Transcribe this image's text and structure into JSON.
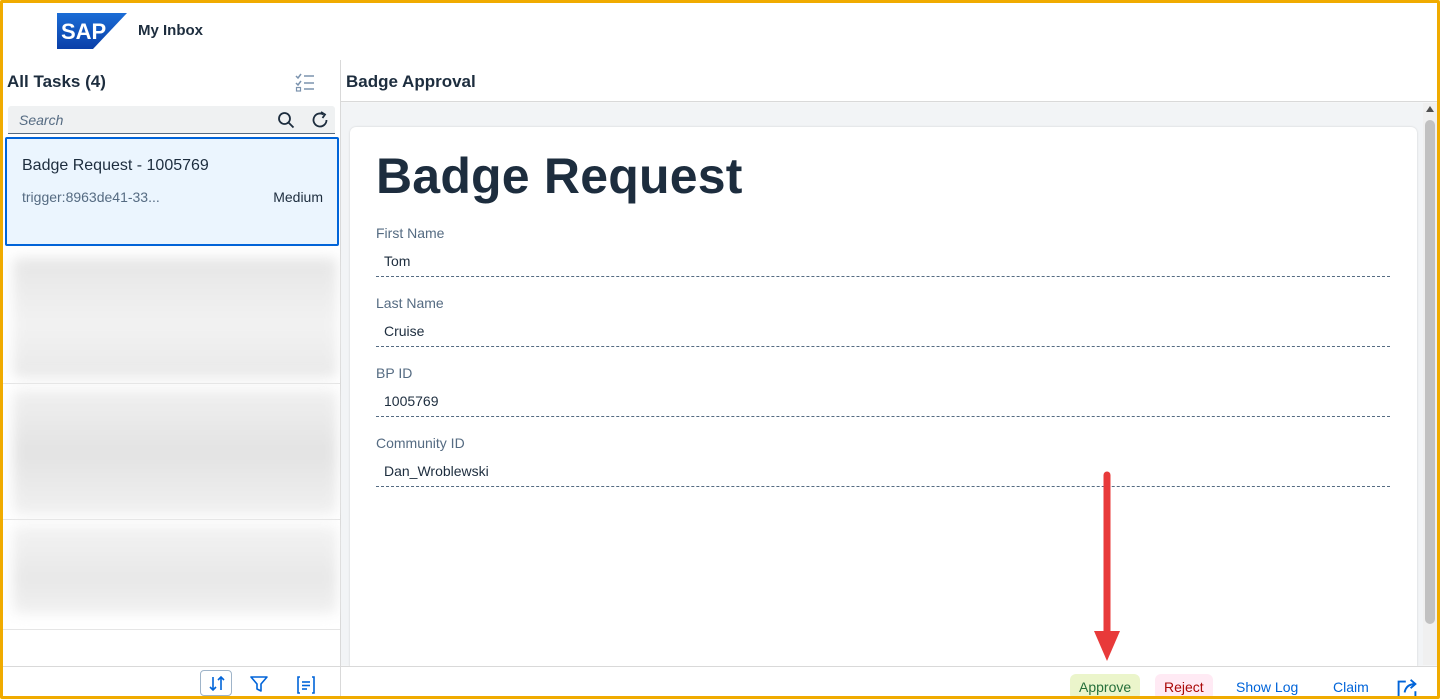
{
  "shell": {
    "logo_text": "SAP",
    "title": "My Inbox"
  },
  "master": {
    "title": "All Tasks (4)",
    "search_placeholder": "Search",
    "tasks": [
      {
        "title": "Badge Request - 1005769",
        "subtitle": "trigger:8963de41-33...",
        "priority": "Medium",
        "selected": true
      }
    ]
  },
  "detail": {
    "title": "Badge Approval",
    "form_title": "Badge Request",
    "fields": [
      {
        "label": "First Name",
        "value": "Tom"
      },
      {
        "label": "Last Name",
        "value": "Cruise"
      },
      {
        "label": "BP ID",
        "value": "1005769"
      },
      {
        "label": "Community ID",
        "value": "Dan_Wroblewski"
      }
    ],
    "actions": {
      "approve": "Approve",
      "reject": "Reject",
      "show_log": "Show Log",
      "claim": "Claim"
    }
  },
  "colors": {
    "accent": "#0064d9",
    "frame": "#f0ab00",
    "approve_bg": "#ebf5cb",
    "reject_bg": "#ffeaf4",
    "annotation_arrow": "#e83a3a"
  },
  "icons": {
    "multi_select": "multi-select-icon",
    "search": "search-icon",
    "refresh": "refresh-icon",
    "sort": "sort-icon",
    "filter": "filter-icon",
    "group": "group-icon",
    "open_external": "open-external-icon"
  }
}
